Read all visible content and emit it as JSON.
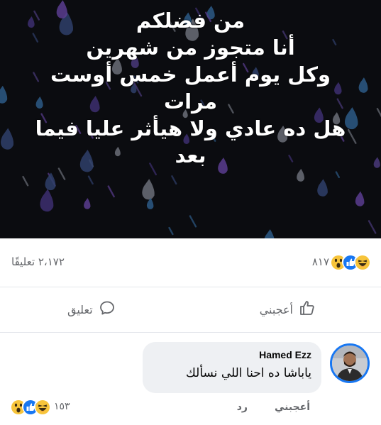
{
  "post": {
    "image_lines": [
      "من فضلكم",
      "أنا متجوز من شهرين",
      "وكل يوم أعمل خمس أوست",
      "مرات",
      "هل ده عادي ولا هيأثر عليا فيما",
      "بعد"
    ]
  },
  "summary": {
    "reactions_count": "٨١٧",
    "reaction_icons": [
      "haha-emoji-icon",
      "like-emoji-icon",
      "wow-emoji-icon"
    ],
    "comments_count": "٢،١٧٢ تعليقًا"
  },
  "actions": {
    "like_label": "أعجبني",
    "comment_label": "تعليق"
  },
  "comment": {
    "author": "Hamed Ezz",
    "text": "ياباشا ده احنا اللي نسألك",
    "like_label": "أعجبني",
    "reply_label": "رد",
    "reactions_count": "١٥٣",
    "reaction_icons": [
      "wow-emoji-icon",
      "like-emoji-icon",
      "haha-emoji-icon"
    ]
  },
  "colors": {
    "facebook_blue": "#1877f2",
    "emoji_yellow": "#f7c43b",
    "secondary_text": "#65676b",
    "bubble_bg": "#eef0f3",
    "image_bg": "#0b0c10"
  }
}
